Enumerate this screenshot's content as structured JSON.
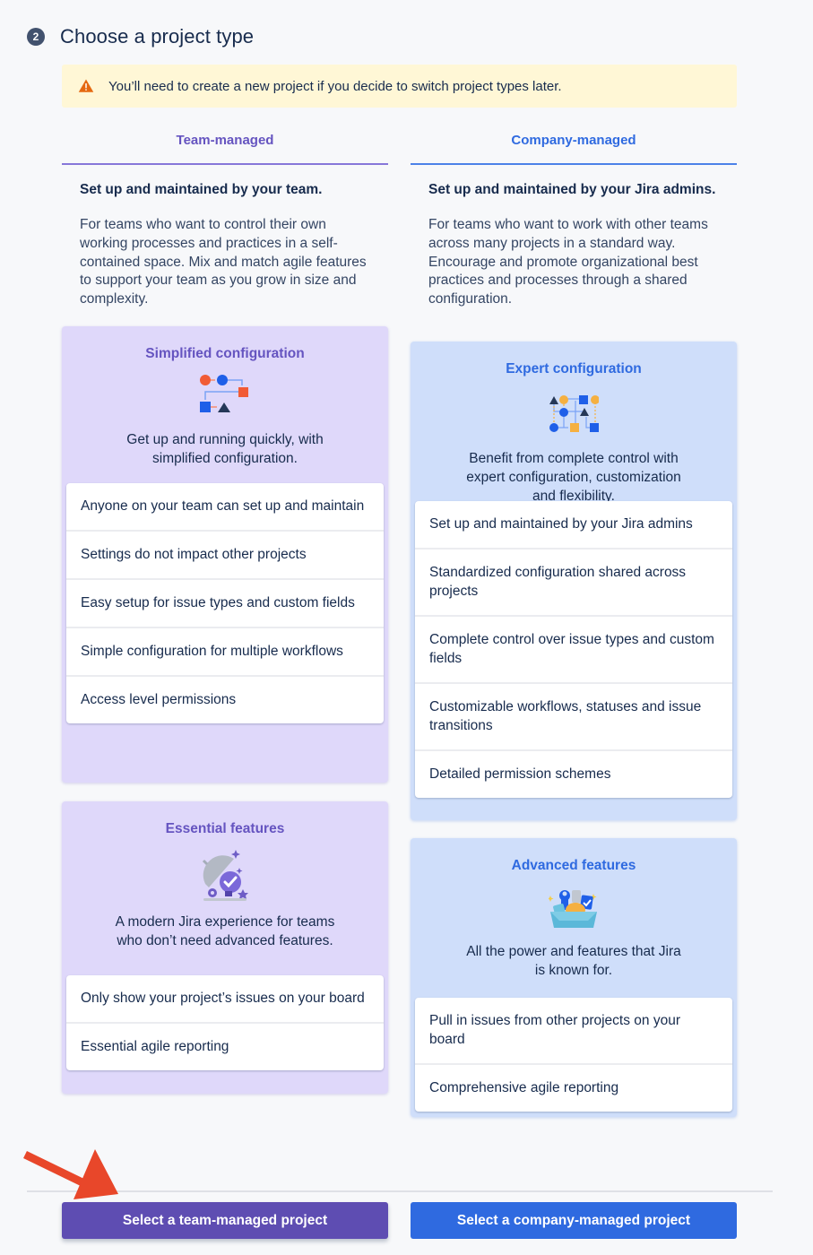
{
  "header": {
    "step_number": "2",
    "title": "Choose a project type"
  },
  "warning": {
    "icon": "warning-triangle-icon",
    "text": "You’ll need to create a new project if you decide to switch project types later."
  },
  "tabs": [
    {
      "label": "Team-managed",
      "color": "#6554c0"
    },
    {
      "label": "Company-managed",
      "color": "#2f6ae0"
    }
  ],
  "team_managed": {
    "lead": "Set up and maintained by your team.",
    "description": "For teams who want to control their own working processes and practices in a self-contained space. Mix and match agile features to support your team as you grow in size and complexity.",
    "config_panel": {
      "title": "Simplified configuration",
      "icon": "workflow-simple-icon",
      "text": "Get up and running quickly, with simplified configuration.",
      "items": [
        "Anyone on your team can set up and maintain",
        "Settings do not impact other projects",
        "Easy setup for issue types and custom fields",
        "Simple configuration for multiple workflows",
        "Access level permissions"
      ]
    },
    "features_panel": {
      "title": "Essential features",
      "icon": "cloche-check-icon",
      "text": "A modern Jira experience for teams who don’t need advanced features.",
      "items": [
        "Only show your project’s issues on your board",
        "Essential agile reporting"
      ]
    },
    "button_label": "Select a team-managed project"
  },
  "company_managed": {
    "lead": "Set up and maintained by your Jira admins.",
    "description": "For teams who want to work with other teams across many projects in a standard way. Encourage and promote organizational best practices and processes through a shared configuration.",
    "config_panel": {
      "title": "Expert configuration",
      "icon": "workflow-complex-icon",
      "text": "Benefit from complete control with expert configuration, customization and flexibility.",
      "items": [
        "Set up and maintained by your Jira admins",
        "Standardized configuration shared across projects",
        "Complete control over issue types and custom fields",
        "Customizable workflows, statuses and issue transitions",
        "Detailed permission schemes"
      ]
    },
    "features_panel": {
      "title": "Advanced features",
      "icon": "toolbox-icon",
      "text": "All the power and features that Jira is known for.",
      "items": [
        "Pull in issues from other projects on your board",
        "Comprehensive agile reporting"
      ]
    },
    "button_label": "Select a company-managed project"
  },
  "colors": {
    "team_accent": "#5e4db2",
    "company_accent": "#2f6ae0",
    "warning_bg": "#fff7d6",
    "annotation_arrow": "#e8472a"
  }
}
